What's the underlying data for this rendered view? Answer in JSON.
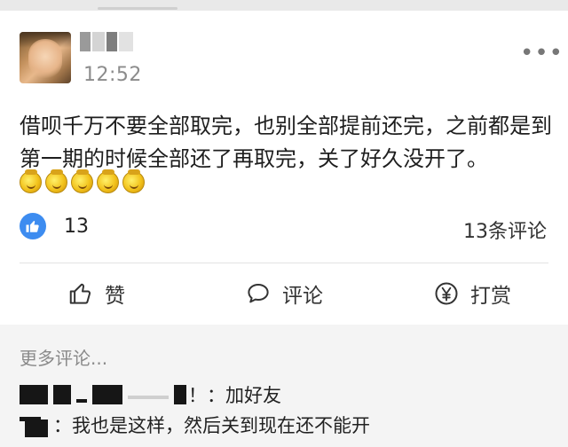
{
  "post": {
    "time": "12:52",
    "text": "借呗千万不要全部取完，也别全部提前还完，之前都是到第一期的时候全部还了再取完，关了好久没开了。",
    "emoji_icon": "smiling-face-emoji",
    "emoji_count": 5,
    "more_icon": "more-dots-icon"
  },
  "stats": {
    "likes": "13",
    "comments": "13条评论",
    "like_badge_color": "#3d8cf0"
  },
  "actions": {
    "like_label": "赞",
    "comment_label": "评论",
    "reward_label": "打赏"
  },
  "comments": {
    "more_label": "更多评论...",
    "items": [
      {
        "name_suffix": "！",
        "text": "：加好友"
      },
      {
        "text": "：我也是这样，然后关到现在还不能开"
      }
    ]
  }
}
